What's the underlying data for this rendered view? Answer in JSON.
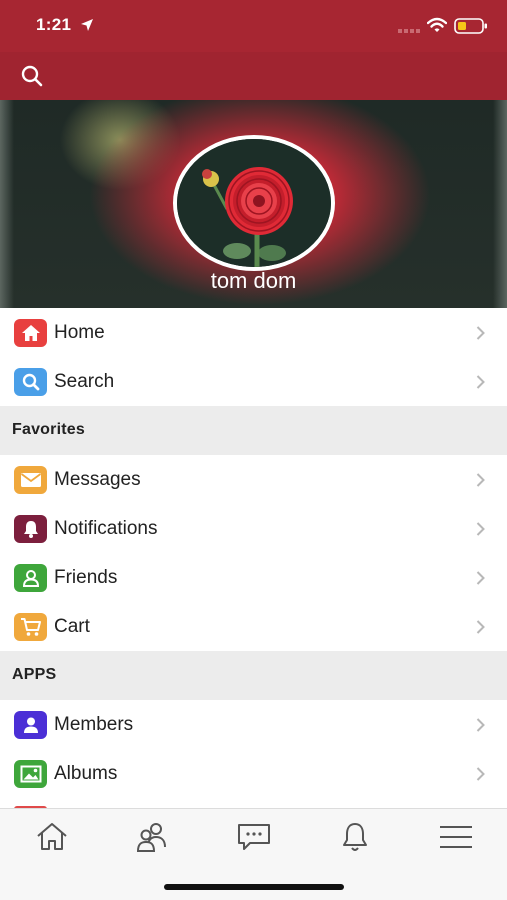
{
  "status_bar": {
    "time": "1:21"
  },
  "header": {
    "search_icon": "search-icon"
  },
  "profile": {
    "name": "tom dom"
  },
  "menu": {
    "top_items": [
      {
        "label": "Home",
        "icon": "home-icon",
        "color": "#e8403f"
      },
      {
        "label": "Search",
        "icon": "search-icon",
        "color": "#4a9fe8"
      }
    ],
    "favorites_header": "Favorites",
    "favorites": [
      {
        "label": "Messages",
        "icon": "envelope-icon",
        "color": "#f0a83c"
      },
      {
        "label": "Notifications",
        "icon": "bell-icon",
        "color": "#7c1f3d"
      },
      {
        "label": "Friends",
        "icon": "person-icon",
        "color": "#3ea63b"
      },
      {
        "label": "Cart",
        "icon": "cart-icon",
        "color": "#f0a83c"
      }
    ],
    "apps_header": "APPS",
    "apps": [
      {
        "label": "Members",
        "icon": "member-icon",
        "color": "#4b2fd6"
      },
      {
        "label": "Albums",
        "icon": "picture-icon",
        "color": "#3ea63b"
      }
    ]
  },
  "tab_bar": [
    {
      "icon": "home-icon"
    },
    {
      "icon": "friends-icon"
    },
    {
      "icon": "chat-icon"
    },
    {
      "icon": "bell-icon"
    },
    {
      "icon": "menu-icon"
    }
  ],
  "colors": {
    "header": "#a72632",
    "section_bg": "#ececec",
    "tab_bar_bg": "#f7f7f7"
  }
}
